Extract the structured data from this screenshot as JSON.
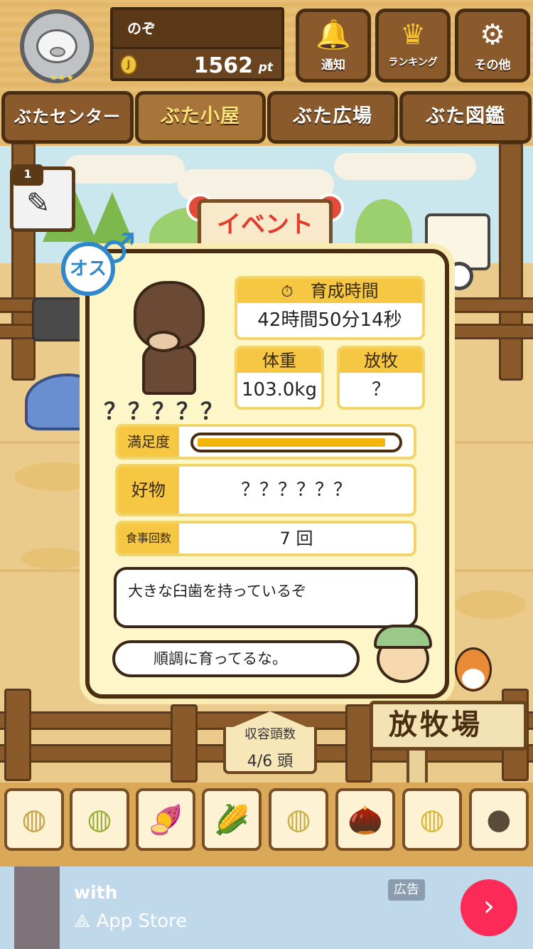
{
  "header": {
    "username": "のぞ",
    "coin_icon": "coin-icon",
    "points": "1562",
    "points_unit": "pt",
    "avatar_icon": "pig-avatar-icon",
    "avatar_stars": "★★★",
    "buttons": [
      {
        "label": "通知",
        "icon": "bell-icon",
        "glyph": "🔔"
      },
      {
        "label": "ランキング",
        "icon": "crown-icon",
        "glyph": "♛"
      },
      {
        "label": "その他",
        "icon": "gear-icon",
        "glyph": "⚙"
      }
    ]
  },
  "tabs": [
    {
      "label": "ぶたセンター",
      "active": false
    },
    {
      "label": "ぶた小屋",
      "active": true
    },
    {
      "label": "ぶた広場",
      "active": false
    },
    {
      "label": "ぶた図鑑",
      "active": false
    }
  ],
  "scene": {
    "event_sign": "イベント",
    "item_count": "1",
    "item_icon": "syringe-icon"
  },
  "card": {
    "gender": "オス",
    "gender_symbol": "♂",
    "name": "？？？？？",
    "growth_time_label": "育成時間",
    "growth_time_value": "42時間50分14秒",
    "weight_label": "体重",
    "weight_value": "103.0kg",
    "grazing_label": "放牧",
    "grazing_value": "？",
    "satisfaction_label": "満足度",
    "satisfaction_level": 0.95,
    "favorite_label": "好物",
    "favorite_value": "？？？？？？",
    "meals_label": "食事回数",
    "meals_value": "7 回",
    "description": "大きな臼歯を持っているぞ",
    "farmer_comment": "順調に育ってるな。"
  },
  "bottom": {
    "capacity_label": "収容頭数",
    "capacity_value": "4/6 頭",
    "pasture_sign": "放牧場",
    "foods": [
      {
        "icon": "grain-pile-icon",
        "glyph": "◍"
      },
      {
        "icon": "mixed-grain-icon",
        "glyph": "◍"
      },
      {
        "icon": "sweet-potato-icon",
        "glyph": "🍠"
      },
      {
        "icon": "corn-icon",
        "glyph": "🌽"
      },
      {
        "icon": "soybean-icon",
        "glyph": "◍"
      },
      {
        "icon": "acorn-icon",
        "glyph": "🌰"
      },
      {
        "icon": "bowl-grain-icon",
        "glyph": "◍"
      },
      {
        "icon": "plate-balls-icon",
        "glyph": "●"
      }
    ]
  },
  "ad": {
    "title": "with",
    "store": "App Store",
    "tag": "広告",
    "go_symbol": "›"
  },
  "colors": {
    "wood": "#8a5a2c",
    "wood_dark": "#4a2e12",
    "card_bg": "#fdf6c9",
    "accent_yellow": "#f6c743",
    "male_blue": "#2e88c9",
    "ad_button": "#fb2a56"
  }
}
